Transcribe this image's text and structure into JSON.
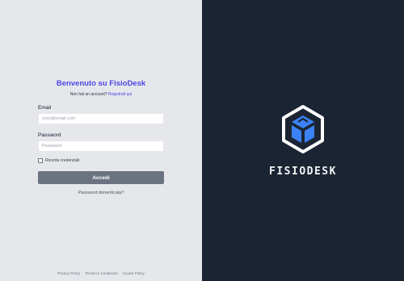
{
  "login": {
    "title": "Benvenuto su FisioDesk",
    "no_account_text": "Non hai un account?",
    "register_link": "Registrati qui",
    "email_label": "Email",
    "email_placeholder": "your@email.com",
    "password_label": "Password",
    "password_placeholder": "Password",
    "remember_label": "Ricorda credenziali",
    "submit_label": "Accedi",
    "forgot_link": "Password dimenticata?"
  },
  "footer": {
    "links": [
      "Privacy Policy",
      "Termini e Condizioni",
      "Cookie Policy"
    ]
  },
  "brand": {
    "name": "FISIODESK",
    "logo_icon": "cube-hexagon-icon"
  },
  "colors": {
    "accent": "#4f46e5",
    "left_bg": "#e5e7eb",
    "right_bg": "#1b2432",
    "logo_blue": "#3b82f6",
    "button_bg": "#6b7280"
  }
}
